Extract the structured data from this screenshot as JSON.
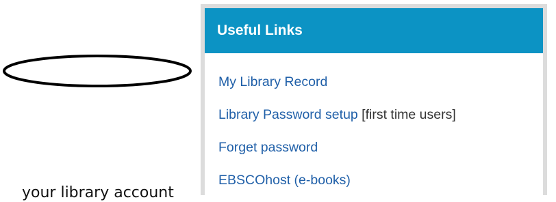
{
  "panel": {
    "title": "Useful Links",
    "header_color": "#0c93c4",
    "links": [
      {
        "label": "My Library Record",
        "note": ""
      },
      {
        "label": "Library Password setup",
        "note": " [first time users]"
      },
      {
        "label": "Forget password",
        "note": ""
      },
      {
        "label": "EBSCOhost (e-books)",
        "note": ""
      }
    ]
  },
  "caption": "your library account"
}
